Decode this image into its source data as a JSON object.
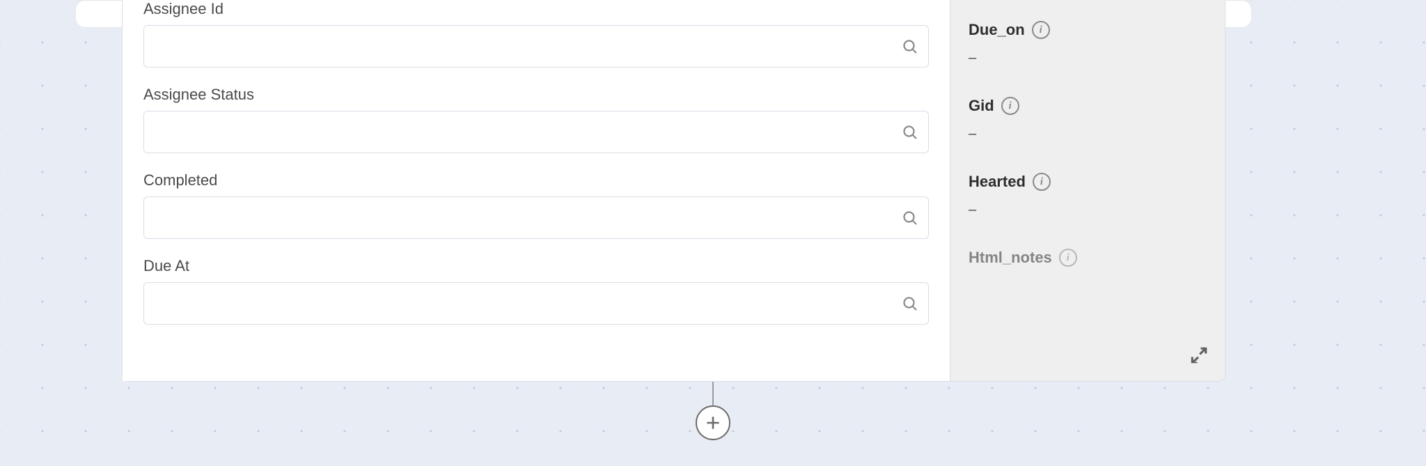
{
  "form": {
    "fields": [
      {
        "label": "Assignee Id",
        "value": ""
      },
      {
        "label": "Assignee Status",
        "value": ""
      },
      {
        "label": "Completed",
        "value": ""
      },
      {
        "label": "Due At",
        "value": ""
      }
    ]
  },
  "side": {
    "items": [
      {
        "label": "Due_on",
        "value": "–",
        "faded": false
      },
      {
        "label": "Gid",
        "value": "–",
        "faded": false
      },
      {
        "label": "Hearted",
        "value": "–",
        "faded": false
      },
      {
        "label": "Html_notes",
        "value": "",
        "faded": true
      }
    ]
  }
}
